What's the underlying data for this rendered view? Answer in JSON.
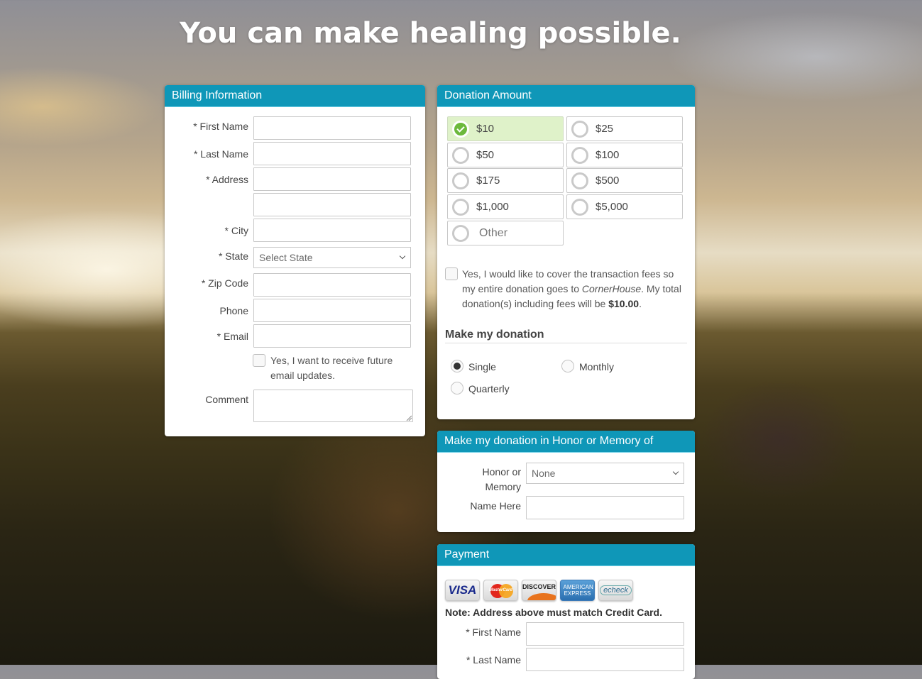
{
  "headline": "You can make healing possible.",
  "billing": {
    "title": "Billing Information",
    "fields": {
      "first_name": "* First Name",
      "last_name": "* Last Name",
      "address": "* Address",
      "city": "* City",
      "state": "* State",
      "zip": "* Zip Code",
      "phone": "Phone",
      "email": "* Email",
      "comment": "Comment"
    },
    "state_selected": "Select State",
    "email_updates_label": "Yes, I want to receive future email updates.",
    "email_updates_checked": false
  },
  "donation": {
    "title": "Donation Amount",
    "amounts": [
      {
        "label": "$10",
        "selected": true
      },
      {
        "label": "$25",
        "selected": false
      },
      {
        "label": "$50",
        "selected": false
      },
      {
        "label": "$100",
        "selected": false
      },
      {
        "label": "$175",
        "selected": false
      },
      {
        "label": "$500",
        "selected": false
      },
      {
        "label": "$1,000",
        "selected": false
      },
      {
        "label": "$5,000",
        "selected": false
      },
      {
        "label": "Other",
        "selected": false
      }
    ],
    "fees": {
      "text_1": "Yes, I would like to cover the transaction fees so my entire donation goes to ",
      "org": "CornerHouse",
      "text_2": ". My total donation(s) including fees will be ",
      "total": "$10.00",
      "text_3": ".",
      "checked": false
    },
    "frequency_heading": "Make my donation",
    "frequency": [
      {
        "label": "Single",
        "selected": true
      },
      {
        "label": "Monthly",
        "selected": false
      },
      {
        "label": "Quarterly",
        "selected": false
      }
    ],
    "selected_color": "#dff2c9",
    "check_color": "#6cb93c"
  },
  "honor": {
    "title": "Make my donation in Honor or Memory of",
    "honor_label_1": "Honor or",
    "honor_label_2": "Memory",
    "honor_selected": "None",
    "name_label": "Name Here"
  },
  "payment": {
    "title": "Payment",
    "cards": [
      "VISA",
      "MasterCard",
      "DISCOVER",
      "AMERICAN EXPRESS",
      "echeck"
    ],
    "note": "Note: Address above must match Credit Card.",
    "first_name": "* First Name",
    "last_name": "* Last Name"
  },
  "theme": {
    "header_color": "#0f97b8"
  }
}
